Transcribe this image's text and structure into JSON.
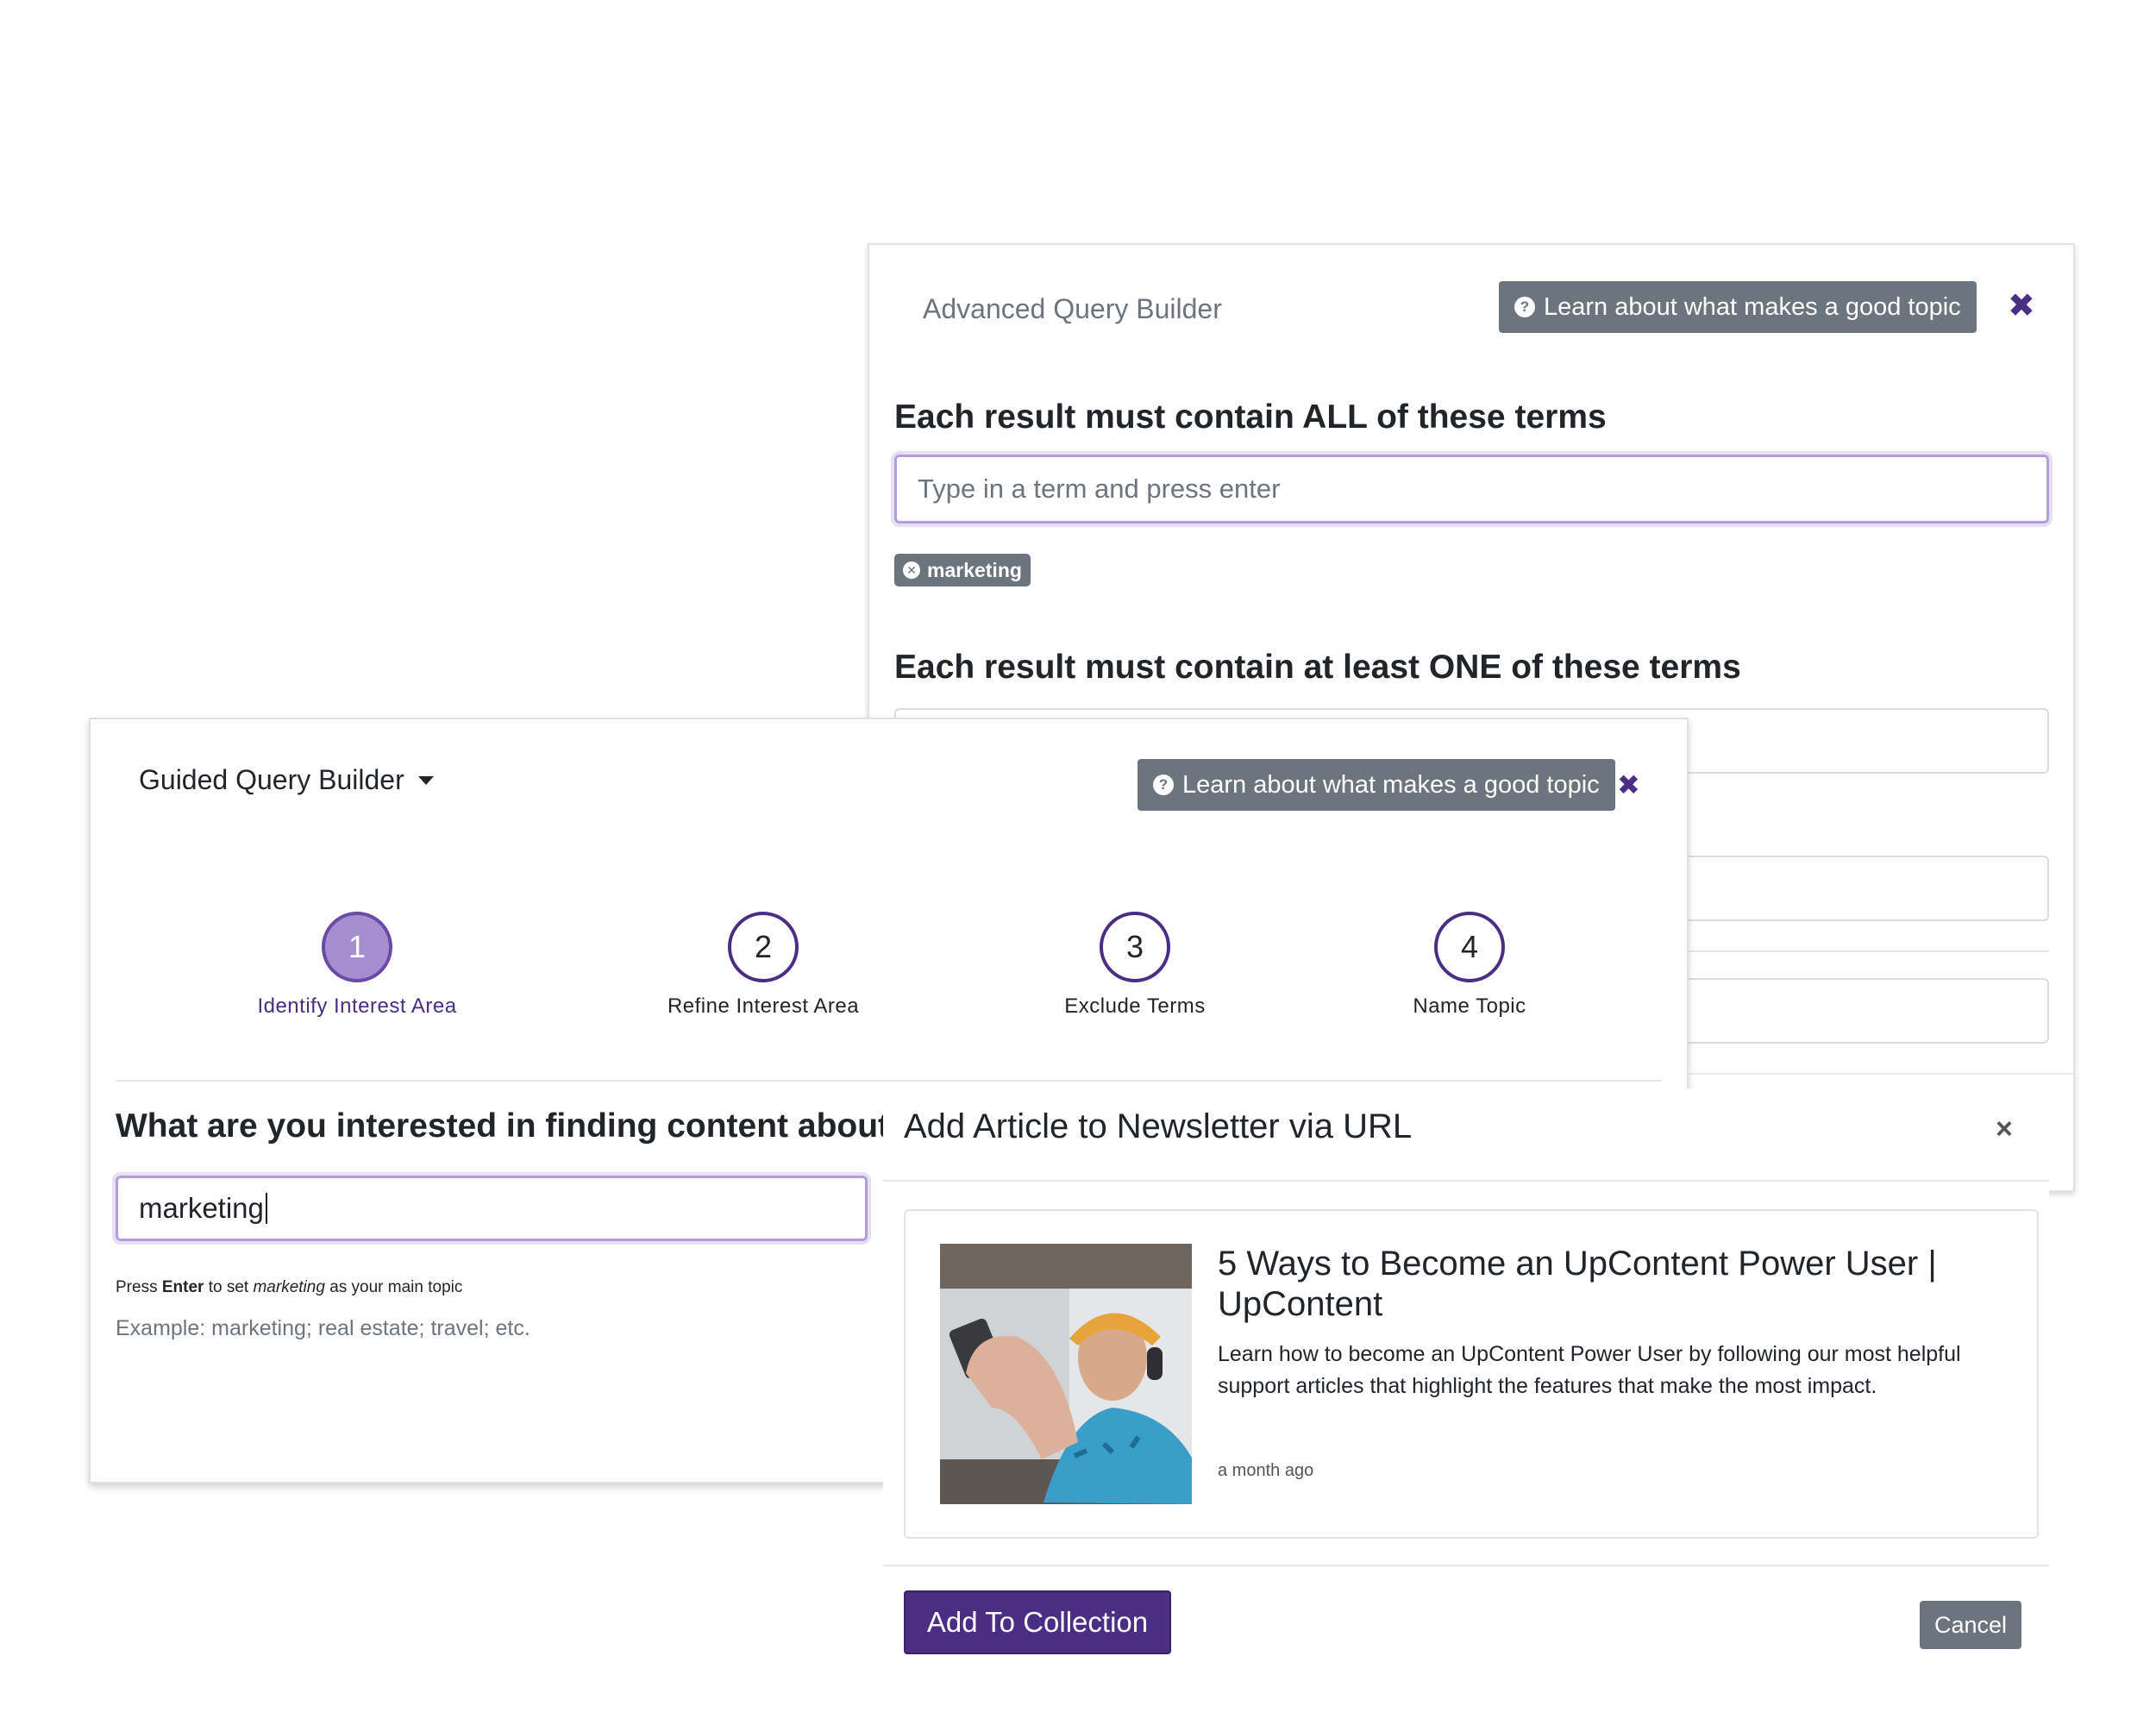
{
  "advanced": {
    "title": "Advanced Query Builder",
    "help_label": "Learn about what makes a good topic",
    "close_label": "✖",
    "all_terms_heading": "Each result must contain ALL of these terms",
    "all_terms_placeholder": "Type in a term and press enter",
    "all_terms_chips": [
      "marketing"
    ],
    "one_terms_heading": "Each result must contain at least ONE of these terms"
  },
  "guided": {
    "title": "Guided Query Builder",
    "help_label": "Learn about what makes a good topic",
    "close_label": "✖",
    "steps": [
      {
        "number": "1",
        "label": "Identify Interest Area"
      },
      {
        "number": "2",
        "label": "Refine Interest Area"
      },
      {
        "number": "3",
        "label": "Exclude Terms"
      },
      {
        "number": "4",
        "label": "Name Topic"
      }
    ],
    "active_step": 1,
    "question": "What are you interested in finding content about?",
    "input_value": "marketing",
    "hint_prefix": "Press",
    "hint_key": "Enter",
    "hint_middle": "to set",
    "hint_term": "marketing",
    "hint_suffix": "as your main topic",
    "example": "Example: marketing; real estate; travel; etc."
  },
  "article_modal": {
    "title": "Add Article to Newsletter via URL",
    "close_label": "×",
    "article": {
      "title": "5 Ways to Become an UpContent Power User | UpContent",
      "description": "Learn how to become an UpContent Power User by following our most helpful support articles that highlight the features that make the most impact.",
      "time": "a month ago"
    },
    "add_button": "Add To Collection",
    "cancel_button": "Cancel"
  },
  "colors": {
    "brand_purple": "#4b2d83",
    "active_step_fill": "#a58ed0",
    "secondary_gray": "#6c757d"
  }
}
